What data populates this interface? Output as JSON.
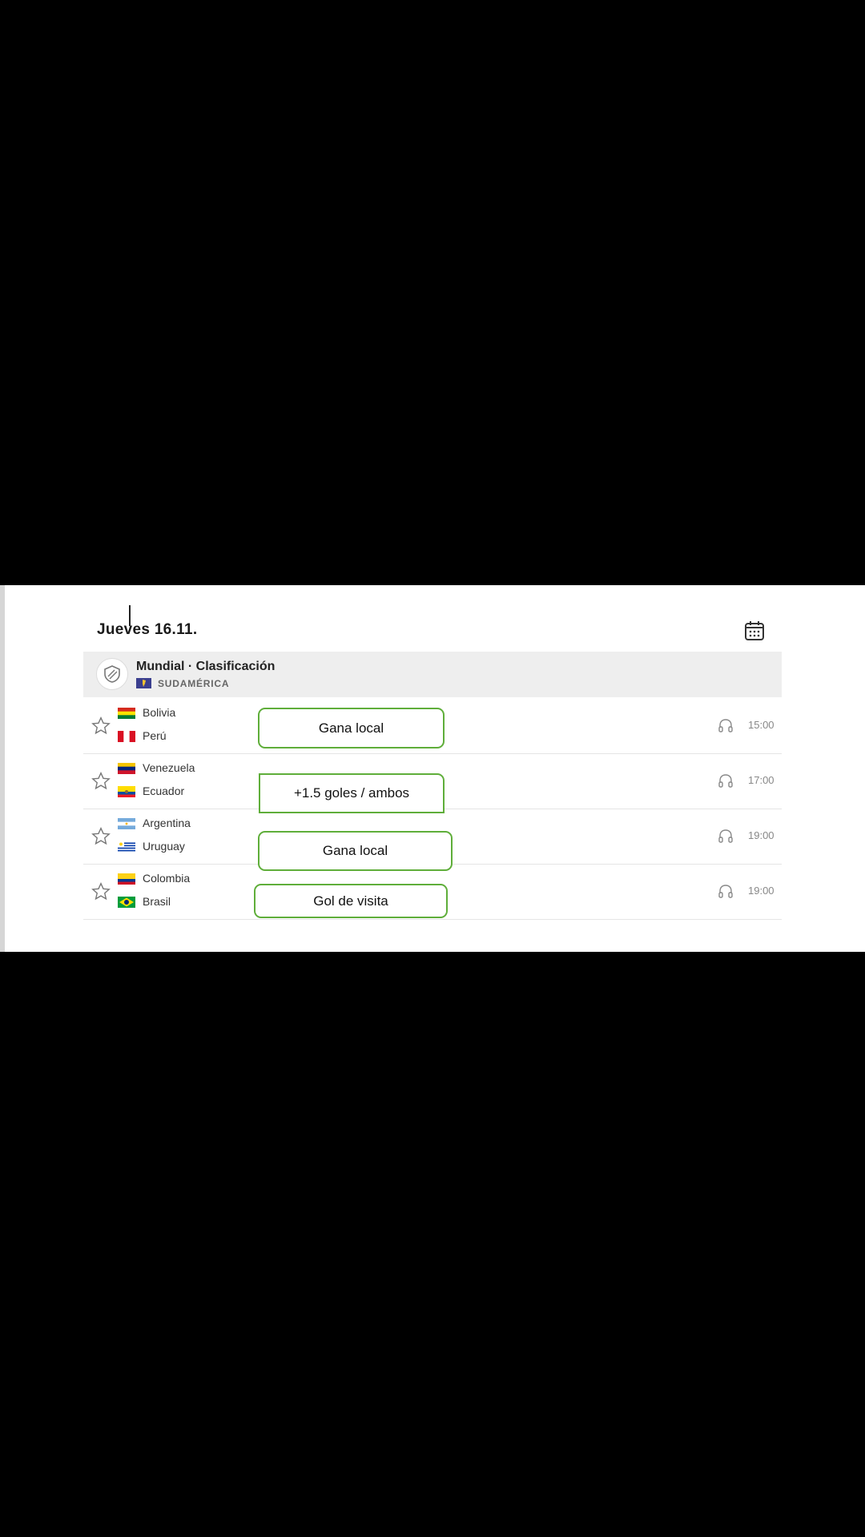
{
  "date_header": {
    "title": "Jueves 16.11."
  },
  "league": {
    "name": "Mundial · Clasificación",
    "region": "SUDAMÉRICA"
  },
  "matches": [
    {
      "home": "Bolivia",
      "away": "Perú",
      "time": "15:00",
      "tip": "Gana local"
    },
    {
      "home": "Venezuela",
      "away": "Ecuador",
      "time": "17:00",
      "tip": "+1.5 goles / ambos"
    },
    {
      "home": "Argentina",
      "away": "Uruguay",
      "time": "19:00",
      "tip": "Gana local"
    },
    {
      "home": "Colombia",
      "away": "Brasil",
      "time": "19:00",
      "tip": "Gol de visita"
    }
  ],
  "icons": {
    "star": "star-outline-icon",
    "audio": "headphones-icon",
    "calendar": "calendar-icon",
    "league": "shield-logo-icon"
  },
  "colors": {
    "tip_border": "#5fae3a",
    "league_bar": "#eeeeee"
  }
}
